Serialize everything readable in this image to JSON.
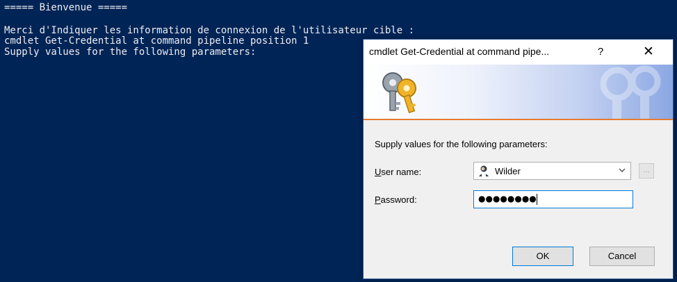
{
  "console": {
    "lines": [
      "===== Bienvenue =====",
      "",
      "Merci d'Indiquer les information de connexion de l'utilisateur cible :",
      "cmdlet Get-Credential at command pipeline position 1",
      "Supply values for the following parameters:"
    ],
    "background": "#012456",
    "text_color": "#eeedf0"
  },
  "dialog": {
    "title": "cmdlet Get-Credential at command pipe...",
    "help_label": "?",
    "close_label": "✕",
    "prompt": "Supply values for the following parameters:",
    "username_label_accel": "U",
    "username_label_rest": "ser name:",
    "username_value": "Wilder",
    "browse_label": "...",
    "password_label_accel": "P",
    "password_label_rest": "assword:",
    "password_value": "●●●●●●●●",
    "ok_label": "OK",
    "cancel_label": "Cancel",
    "icons": {
      "banner": "keys-icon",
      "user": "user-icon",
      "dropdown": "chevron-down-icon"
    },
    "colors": {
      "accent": "#0078d7",
      "banner_stripe": "#e87a2e"
    }
  }
}
